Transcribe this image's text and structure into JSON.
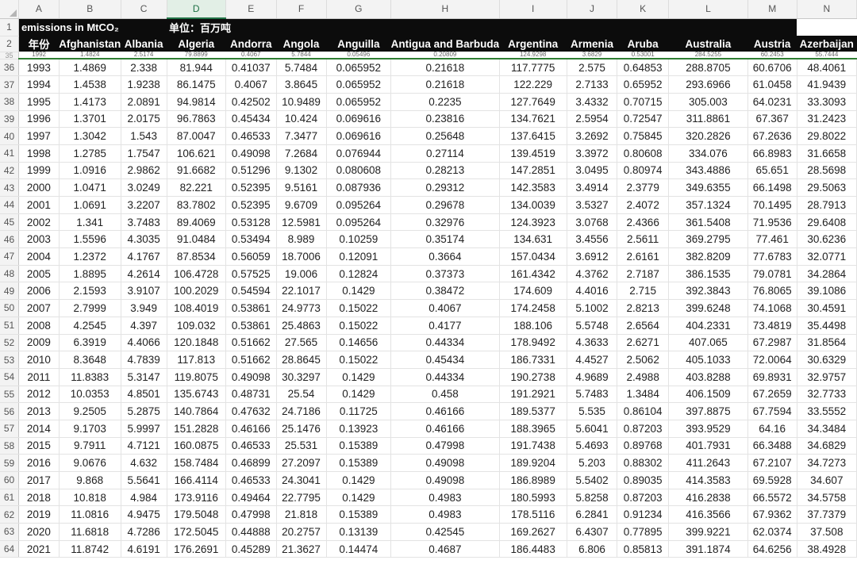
{
  "sheet": {
    "columns": [
      "A",
      "B",
      "C",
      "D",
      "E",
      "F",
      "G",
      "H",
      "I",
      "J",
      "K",
      "L",
      "M",
      "N"
    ],
    "selected_column": "D",
    "header_row_1": {
      "row_number": "1",
      "title": "emissions in MtCO₂",
      "unit": "单位：百万吨"
    },
    "header_row_2": {
      "row_number": "2",
      "cells": [
        "年份",
        "Afghanistan",
        "Albania",
        "Algeria",
        "Andorra",
        "Angola",
        "Anguilla",
        "Antigua and Barbuda",
        "Argentina",
        "Armenia",
        "Aruba",
        "Australia",
        "Austria",
        "Azerbaijan"
      ]
    },
    "partial_row": {
      "row_number": "35",
      "cells": [
        "1992",
        "1.4824",
        "2.5174",
        "79.8899",
        "0.4067",
        "5.7844",
        "0.05496",
        "0.20809",
        "124.9298",
        "3.6829",
        "0.53001",
        "284.5255",
        "60.2453",
        "55.7444"
      ]
    },
    "rows": [
      {
        "n": "36",
        "cells": [
          "1993",
          "1.4869",
          "2.338",
          "81.944",
          "0.41037",
          "5.7484",
          "0.065952",
          "0.21618",
          "117.7775",
          "2.575",
          "0.64853",
          "288.8705",
          "60.6706",
          "48.4061"
        ]
      },
      {
        "n": "37",
        "cells": [
          "1994",
          "1.4538",
          "1.9238",
          "86.1475",
          "0.4067",
          "3.8645",
          "0.065952",
          "0.21618",
          "122.229",
          "2.7133",
          "0.65952",
          "293.6966",
          "61.0458",
          "41.9439"
        ]
      },
      {
        "n": "38",
        "cells": [
          "1995",
          "1.4173",
          "2.0891",
          "94.9814",
          "0.42502",
          "10.9489",
          "0.065952",
          "0.2235",
          "127.7649",
          "3.4332",
          "0.70715",
          "305.003",
          "64.0231",
          "33.3093"
        ]
      },
      {
        "n": "39",
        "cells": [
          "1996",
          "1.3701",
          "2.0175",
          "96.7863",
          "0.45434",
          "10.424",
          "0.069616",
          "0.23816",
          "134.7621",
          "2.5954",
          "0.72547",
          "311.8861",
          "67.367",
          "31.2423"
        ]
      },
      {
        "n": "40",
        "cells": [
          "1997",
          "1.3042",
          "1.543",
          "87.0047",
          "0.46533",
          "7.3477",
          "0.069616",
          "0.25648",
          "137.6415",
          "3.2692",
          "0.75845",
          "320.2826",
          "67.2636",
          "29.8022"
        ]
      },
      {
        "n": "41",
        "cells": [
          "1998",
          "1.2785",
          "1.7547",
          "106.621",
          "0.49098",
          "7.2684",
          "0.076944",
          "0.27114",
          "139.4519",
          "3.3972",
          "0.80608",
          "334.076",
          "66.8983",
          "31.6658"
        ]
      },
      {
        "n": "42",
        "cells": [
          "1999",
          "1.0916",
          "2.9862",
          "91.6682",
          "0.51296",
          "9.1302",
          "0.080608",
          "0.28213",
          "147.2851",
          "3.0495",
          "0.80974",
          "343.4886",
          "65.651",
          "28.5698"
        ]
      },
      {
        "n": "43",
        "cells": [
          "2000",
          "1.0471",
          "3.0249",
          "82.221",
          "0.52395",
          "9.5161",
          "0.087936",
          "0.29312",
          "142.3583",
          "3.4914",
          "2.3779",
          "349.6355",
          "66.1498",
          "29.5063"
        ]
      },
      {
        "n": "44",
        "cells": [
          "2001",
          "1.0691",
          "3.2207",
          "83.7802",
          "0.52395",
          "9.6709",
          "0.095264",
          "0.29678",
          "134.0039",
          "3.5327",
          "2.4072",
          "357.1324",
          "70.1495",
          "28.7913"
        ]
      },
      {
        "n": "45",
        "cells": [
          "2002",
          "1.341",
          "3.7483",
          "89.4069",
          "0.53128",
          "12.5981",
          "0.095264",
          "0.32976",
          "124.3923",
          "3.0768",
          "2.4366",
          "361.5408",
          "71.9536",
          "29.6408"
        ]
      },
      {
        "n": "46",
        "cells": [
          "2003",
          "1.5596",
          "4.3035",
          "91.0484",
          "0.53494",
          "8.989",
          "0.10259",
          "0.35174",
          "134.631",
          "3.4556",
          "2.5611",
          "369.2795",
          "77.461",
          "30.6236"
        ]
      },
      {
        "n": "47",
        "cells": [
          "2004",
          "1.2372",
          "4.1767",
          "87.8534",
          "0.56059",
          "18.7006",
          "0.12091",
          "0.3664",
          "157.0434",
          "3.6912",
          "2.6161",
          "382.8209",
          "77.6783",
          "32.0771"
        ]
      },
      {
        "n": "48",
        "cells": [
          "2005",
          "1.8895",
          "4.2614",
          "106.4728",
          "0.57525",
          "19.006",
          "0.12824",
          "0.37373",
          "161.4342",
          "4.3762",
          "2.7187",
          "386.1535",
          "79.0781",
          "34.2864"
        ]
      },
      {
        "n": "49",
        "cells": [
          "2006",
          "2.1593",
          "3.9107",
          "100.2029",
          "0.54594",
          "22.1017",
          "0.1429",
          "0.38472",
          "174.609",
          "4.4016",
          "2.715",
          "392.3843",
          "76.8065",
          "39.1086"
        ]
      },
      {
        "n": "50",
        "cells": [
          "2007",
          "2.7999",
          "3.949",
          "108.4019",
          "0.53861",
          "24.9773",
          "0.15022",
          "0.4067",
          "174.2458",
          "5.1002",
          "2.8213",
          "399.6248",
          "74.1068",
          "30.4591"
        ]
      },
      {
        "n": "51",
        "cells": [
          "2008",
          "4.2545",
          "4.397",
          "109.032",
          "0.53861",
          "25.4863",
          "0.15022",
          "0.4177",
          "188.106",
          "5.5748",
          "2.6564",
          "404.2331",
          "73.4819",
          "35.4498"
        ]
      },
      {
        "n": "52",
        "cells": [
          "2009",
          "6.3919",
          "4.4066",
          "120.1848",
          "0.51662",
          "27.565",
          "0.14656",
          "0.44334",
          "178.9492",
          "4.3633",
          "2.6271",
          "407.065",
          "67.2987",
          "31.8564"
        ]
      },
      {
        "n": "53",
        "cells": [
          "2010",
          "8.3648",
          "4.7839",
          "117.813",
          "0.51662",
          "28.8645",
          "0.15022",
          "0.45434",
          "186.7331",
          "4.4527",
          "2.5062",
          "405.1033",
          "72.0064",
          "30.6329"
        ]
      },
      {
        "n": "54",
        "cells": [
          "2011",
          "11.8383",
          "5.3147",
          "119.8075",
          "0.49098",
          "30.3297",
          "0.1429",
          "0.44334",
          "190.2738",
          "4.9689",
          "2.4988",
          "403.8288",
          "69.8931",
          "32.9757"
        ]
      },
      {
        "n": "55",
        "cells": [
          "2012",
          "10.0353",
          "4.8501",
          "135.6743",
          "0.48731",
          "25.54",
          "0.1429",
          "0.458",
          "191.2921",
          "5.7483",
          "1.3484",
          "406.1509",
          "67.2659",
          "32.7733"
        ]
      },
      {
        "n": "56",
        "cells": [
          "2013",
          "9.2505",
          "5.2875",
          "140.7864",
          "0.47632",
          "24.7186",
          "0.11725",
          "0.46166",
          "189.5377",
          "5.535",
          "0.86104",
          "397.8875",
          "67.7594",
          "33.5552"
        ]
      },
      {
        "n": "57",
        "cells": [
          "2014",
          "9.1703",
          "5.9997",
          "151.2828",
          "0.46166",
          "25.1476",
          "0.13923",
          "0.46166",
          "188.3965",
          "5.6041",
          "0.87203",
          "393.9529",
          "64.16",
          "34.3484"
        ]
      },
      {
        "n": "58",
        "cells": [
          "2015",
          "9.7911",
          "4.7121",
          "160.0875",
          "0.46533",
          "25.531",
          "0.15389",
          "0.47998",
          "191.7438",
          "5.4693",
          "0.89768",
          "401.7931",
          "66.3488",
          "34.6829"
        ]
      },
      {
        "n": "59",
        "cells": [
          "2016",
          "9.0676",
          "4.632",
          "158.7484",
          "0.46899",
          "27.2097",
          "0.15389",
          "0.49098",
          "189.9204",
          "5.203",
          "0.88302",
          "411.2643",
          "67.2107",
          "34.7273"
        ]
      },
      {
        "n": "60",
        "cells": [
          "2017",
          "9.868",
          "5.5641",
          "166.4114",
          "0.46533",
          "24.3041",
          "0.1429",
          "0.49098",
          "186.8989",
          "5.5402",
          "0.89035",
          "414.3583",
          "69.5928",
          "34.607"
        ]
      },
      {
        "n": "61",
        "cells": [
          "2018",
          "10.818",
          "4.984",
          "173.9116",
          "0.49464",
          "22.7795",
          "0.1429",
          "0.4983",
          "180.5993",
          "5.8258",
          "0.87203",
          "416.2838",
          "66.5572",
          "34.5758"
        ]
      },
      {
        "n": "62",
        "cells": [
          "2019",
          "11.0816",
          "4.9475",
          "179.5048",
          "0.47998",
          "21.818",
          "0.15389",
          "0.4983",
          "178.5116",
          "6.2841",
          "0.91234",
          "416.3566",
          "67.9362",
          "37.7379"
        ]
      },
      {
        "n": "63",
        "cells": [
          "2020",
          "11.6818",
          "4.7286",
          "172.5045",
          "0.44888",
          "20.2757",
          "0.13139",
          "0.42545",
          "169.2627",
          "6.4307",
          "0.77895",
          "399.9221",
          "62.0374",
          "37.508"
        ]
      },
      {
        "n": "64",
        "cells": [
          "2021",
          "11.8742",
          "4.6191",
          "176.2691",
          "0.45289",
          "21.3627",
          "0.14474",
          "0.4687",
          "186.4483",
          "6.806",
          "0.85813",
          "391.1874",
          "64.6256",
          "38.4928"
        ]
      }
    ]
  },
  "colors": {
    "header_band": "#0c0c0c",
    "selected_column_accent": "#217346",
    "frozen_divider": "#2e7d32"
  }
}
